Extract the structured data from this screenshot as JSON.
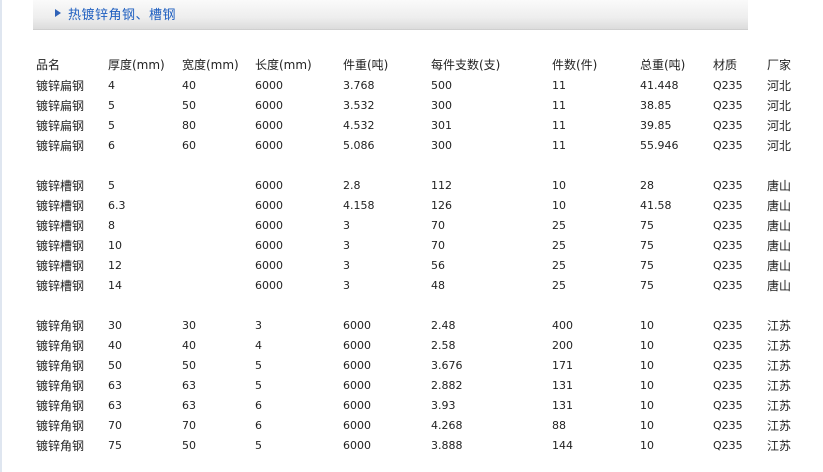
{
  "header": {
    "title": "热镀锌角钢、槽钢"
  },
  "table": {
    "columns": [
      "品名",
      "厚度(mm)",
      "宽度(mm)",
      "长度(mm)",
      "件重(吨)",
      "每件支数(支)",
      "件数(件)",
      "总重(吨)",
      "材质",
      "厂家"
    ],
    "groups": [
      {
        "rows": [
          [
            "镀锌扁钢",
            "4",
            "40",
            "6000",
            "3.768",
            "500",
            "11",
            "41.448",
            "Q235",
            "河北"
          ],
          [
            "镀锌扁钢",
            "5",
            "50",
            "6000",
            "3.532",
            "300",
            "11",
            "38.85",
            "Q235",
            "河北"
          ],
          [
            "镀锌扁钢",
            "5",
            "80",
            "6000",
            "4.532",
            "301",
            "11",
            "39.85",
            "Q235",
            "河北"
          ],
          [
            "镀锌扁钢",
            "6",
            "60",
            "6000",
            "5.086",
            "300",
            "11",
            "55.946",
            "Q235",
            "河北"
          ]
        ]
      },
      {
        "rows": [
          [
            "镀锌槽钢",
            "5",
            "",
            "6000",
            "2.8",
            "112",
            "10",
            "28",
            "Q235",
            "唐山"
          ],
          [
            "镀锌槽钢",
            "6.3",
            "",
            "6000",
            "4.158",
            "126",
            "10",
            "41.58",
            "Q235",
            "唐山"
          ],
          [
            "镀锌槽钢",
            "8",
            "",
            "6000",
            "3",
            "70",
            "25",
            "75",
            "Q235",
            "唐山"
          ],
          [
            "镀锌槽钢",
            "10",
            "",
            "6000",
            "3",
            "70",
            "25",
            "75",
            "Q235",
            "唐山"
          ],
          [
            "镀锌槽钢",
            "12",
            "",
            "6000",
            "3",
            "56",
            "25",
            "75",
            "Q235",
            "唐山"
          ],
          [
            "镀锌槽钢",
            "14",
            "",
            "6000",
            "3",
            "48",
            "25",
            "75",
            "Q235",
            "唐山"
          ]
        ]
      },
      {
        "rows": [
          [
            "镀锌角钢",
            "30",
            "30",
            "3",
            "6000",
            "2.48",
            "400",
            "10",
            "Q235",
            "江苏"
          ],
          [
            "镀锌角钢",
            "40",
            "40",
            "4",
            "6000",
            "2.58",
            "200",
            "10",
            "Q235",
            "江苏"
          ],
          [
            "镀锌角钢",
            "50",
            "50",
            "5",
            "6000",
            "3.676",
            "171",
            "10",
            "Q235",
            "江苏"
          ],
          [
            "镀锌角钢",
            "63",
            "63",
            "5",
            "6000",
            "2.882",
            "131",
            "10",
            "Q235",
            "江苏"
          ],
          [
            "镀锌角钢",
            "63",
            "63",
            "6",
            "6000",
            "3.93",
            "131",
            "10",
            "Q235",
            "江苏"
          ],
          [
            "镀锌角钢",
            "70",
            "70",
            "6",
            "6000",
            "4.268",
            "88",
            "10",
            "Q235",
            "江苏"
          ],
          [
            "镀锌角钢",
            "75",
            "50",
            "5",
            "6000",
            "3.888",
            "144",
            "10",
            "Q235",
            "江苏"
          ]
        ]
      }
    ]
  }
}
